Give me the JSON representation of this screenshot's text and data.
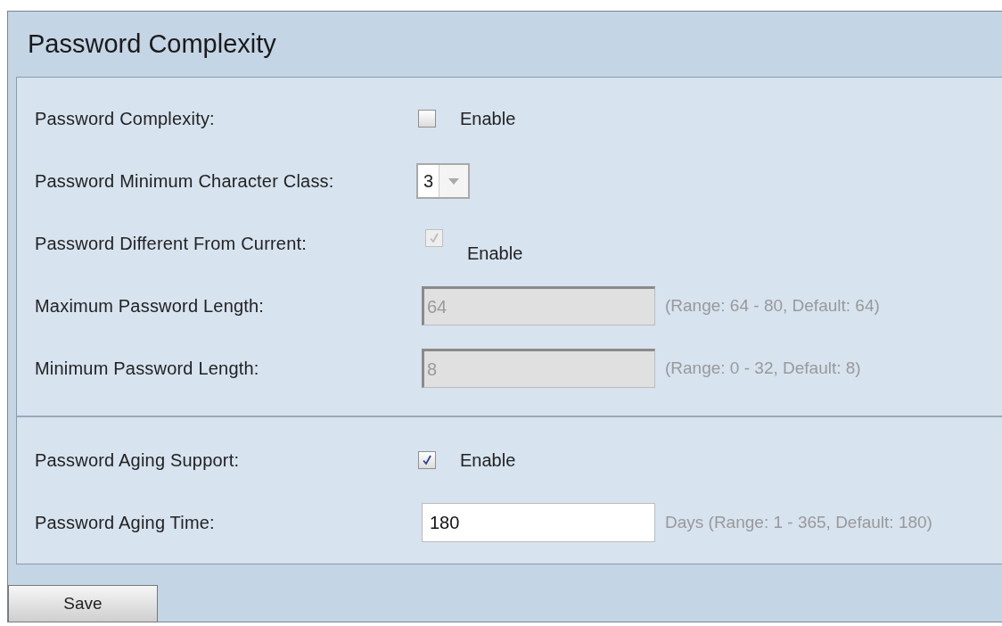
{
  "title": "Password Complexity",
  "sections": [
    {
      "rows": [
        {
          "kind": "checkbox",
          "label": "Password Complexity:",
          "checked": false,
          "disabled": false,
          "option_label": "Enable"
        },
        {
          "kind": "select",
          "label": "Password Minimum Character Class:",
          "value": "3"
        },
        {
          "kind": "checkbox",
          "label": "Password Different From Current:",
          "checked": true,
          "disabled": true,
          "option_label": "Enable"
        },
        {
          "kind": "text",
          "label": "Maximum Password Length:",
          "value": "64",
          "disabled": true,
          "hint": "(Range: 64 - 80, Default: 64)"
        },
        {
          "kind": "text",
          "label": "Minimum Password Length:",
          "value": "8",
          "disabled": true,
          "hint": "(Range: 0 - 32, Default: 8)"
        }
      ]
    },
    {
      "rows": [
        {
          "kind": "checkbox",
          "label": "Password Aging Support:",
          "checked": true,
          "disabled": false,
          "option_label": "Enable"
        },
        {
          "kind": "text",
          "label": "Password Aging Time:",
          "value": "180",
          "disabled": false,
          "hint": "Days (Range: 1 - 365, Default: 180)"
        }
      ]
    }
  ],
  "buttons": [
    {
      "label": "Save"
    }
  ]
}
